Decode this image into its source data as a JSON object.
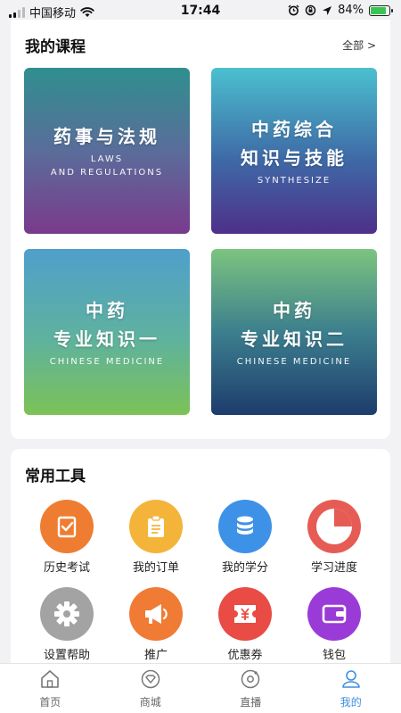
{
  "status_bar": {
    "carrier": "中国移动",
    "time": "17:44",
    "battery_percent": "84%",
    "battery_level": 0.84,
    "battery_color": "#39c552"
  },
  "courses_section": {
    "title": "我的课程",
    "see_all": "全部 >",
    "courses": [
      {
        "cn_lines": [
          "药事与法规"
        ],
        "en_lines": [
          "LAWS",
          "AND REGULATIONS"
        ]
      },
      {
        "cn_lines": [
          "中药综合",
          "知识与技能"
        ],
        "en_lines": [
          "SYNTHESIZE"
        ]
      },
      {
        "cn_lines": [
          "中药",
          "专业知识一"
        ],
        "en_lines": [
          "CHINESE MEDICINE"
        ]
      },
      {
        "cn_lines": [
          "中药",
          "专业知识二"
        ],
        "en_lines": [
          "CHINESE MEDICINE"
        ]
      }
    ]
  },
  "tools_section": {
    "title": "常用工具",
    "tools": [
      {
        "label": "历史考试",
        "icon": "exam-check-icon",
        "color": "#ef7d31"
      },
      {
        "label": "我的订单",
        "icon": "clipboard-icon",
        "color": "#f4b43a"
      },
      {
        "label": "我的学分",
        "icon": "database-coins-icon",
        "color": "#3d92e8"
      },
      {
        "label": "学习进度",
        "icon": "progress-pie-icon",
        "color": "#e65c55"
      },
      {
        "label": "设置帮助",
        "icon": "gear-icon",
        "color": "#a3a3a3"
      },
      {
        "label": "推广",
        "icon": "megaphone-icon",
        "color": "#f07b35"
      },
      {
        "label": "优惠券",
        "icon": "coupon-yen-icon",
        "color": "#e94b45"
      },
      {
        "label": "钱包",
        "icon": "wallet-icon",
        "color": "#9a3bd8"
      }
    ]
  },
  "tab_bar": {
    "tabs": [
      {
        "label": "首页",
        "icon": "home-icon"
      },
      {
        "label": "商城",
        "icon": "shop-icon"
      },
      {
        "label": "直播",
        "icon": "live-icon"
      },
      {
        "label": "我的",
        "icon": "user-icon",
        "active": true
      }
    ],
    "active_color": "#3d8fe0"
  }
}
